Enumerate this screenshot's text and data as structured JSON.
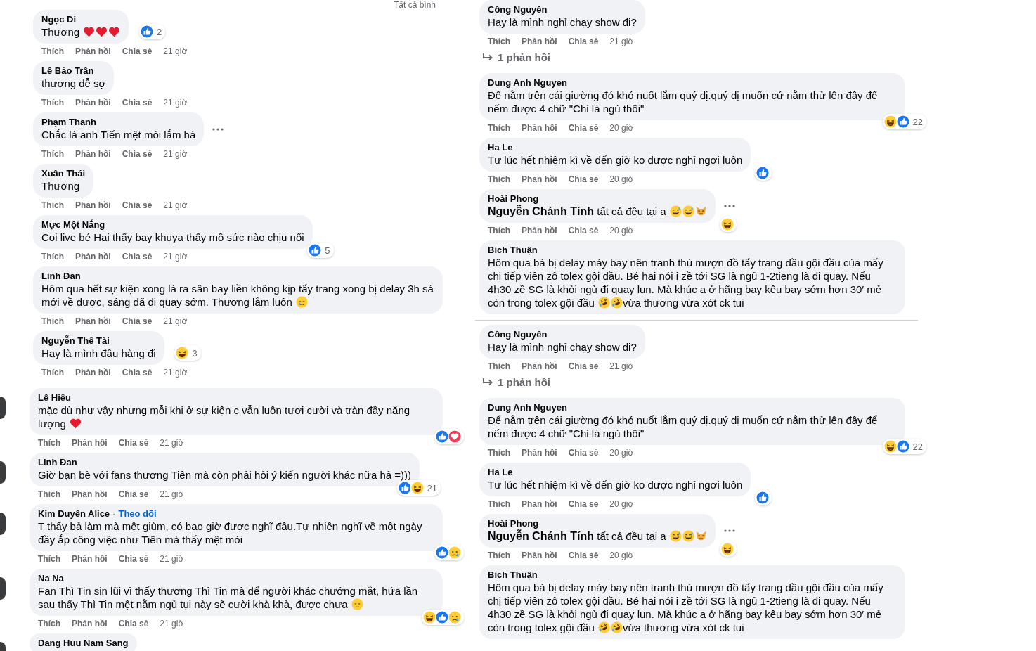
{
  "left_panels": [
    {
      "header": "Tất cả bình",
      "comments": [
        {
          "kind": "comment",
          "author": "Ngọc Di",
          "body": [
            {
              "kind": "text",
              "text": "Thương"
            },
            {
              "kind": "heart"
            },
            {
              "kind": "heart"
            },
            {
              "kind": "heart"
            }
          ],
          "reactions": {
            "icons": [
              {
                "kind": "like"
              }
            ],
            "count": "2"
          },
          "actions": [
            "Thích",
            "Phản hồi",
            "Chia sẻ"
          ],
          "time": "21 giờ"
        },
        {
          "kind": "comment",
          "author": "Lê Bảo Trân",
          "body": [
            {
              "kind": "text",
              "text": "thương dễ sợ"
            }
          ],
          "actions": [
            "Thích",
            "Phản hồi",
            "Chia sẻ"
          ],
          "time": "21 giờ"
        },
        {
          "kind": "comment",
          "author": "Phạm Thanh",
          "body": [
            {
              "kind": "text",
              "text": "Chắc là anh Tiến mệt mỏi lắm hả"
            }
          ],
          "menu": true,
          "actions": [
            "Thích",
            "Phản hồi",
            "Chia sẻ"
          ],
          "time": "21 giờ"
        },
        {
          "kind": "comment",
          "author": "Xuân Thái",
          "body": [
            {
              "kind": "text",
              "text": "Thương"
            }
          ],
          "actions": [
            "Thích",
            "Phản hồi",
            "Chia sẻ"
          ],
          "time": "21 giờ"
        },
        {
          "kind": "comment",
          "author": "Mực Một Nắng",
          "body": [
            {
              "kind": "text",
              "text": "Coi live bé Hai thấy bay khuya thấy mồ sức nào chịu nổi"
            }
          ],
          "reactions": {
            "icons": [
              {
                "kind": "like"
              }
            ],
            "count": "5"
          },
          "actions": [
            "Thích",
            "Phản hồi",
            "Chia sẻ"
          ],
          "time": "21 giờ"
        },
        {
          "kind": "comment",
          "author": "Linh Đan",
          "body": [
            {
              "kind": "text",
              "text": "Hôm qua hết sự kiện xong là ra sân bay liền không kịp tẩy trang xong bị delay 3h sá mới về được, sáng đã đi quay sớm. Thương lắm luôn"
            },
            {
              "kind": "cry"
            }
          ],
          "actions": [
            "Thích",
            "Phản hồi",
            "Chia sẻ"
          ],
          "time": "21 giờ"
        },
        {
          "kind": "comment",
          "author": "Nguyễn Thế Tài",
          "body": [
            {
              "kind": "text",
              "text": "Hay là mình đầu hàng đi"
            }
          ],
          "reactions": {
            "icons": [
              {
                "kind": "haha"
              }
            ],
            "count": "3"
          },
          "actions": [
            "Thích",
            "Phản hồi",
            "Chia sẻ"
          ],
          "time": "21 giờ"
        }
      ]
    },
    {
      "comments": [
        {
          "kind": "comment",
          "avatar": true,
          "author": "Lê Hiếu",
          "body": [
            {
              "kind": "text",
              "text": "mặc dù như vậy nhưng mỗi khi ở sự kiện c vẫn luôn tươi cười và tràn đầy năng lượng"
            },
            {
              "kind": "heart"
            }
          ],
          "reactions": {
            "icons": [
              {
                "kind": "like"
              },
              {
                "kind": "love"
              }
            ]
          },
          "actions": [
            "Thích",
            "Phản hồi",
            "Chia sẻ"
          ],
          "time": "21 giờ"
        },
        {
          "kind": "comment",
          "avatar": true,
          "author": "Linh Đan",
          "body": [
            {
              "kind": "text",
              "text": "Giờ bạn bè với fans thương Tiên mà còn phải hỏi ý kiến người khác nữa hả =)))"
            }
          ],
          "reactions": {
            "icons": [
              {
                "kind": "like"
              },
              {
                "kind": "haha"
              }
            ],
            "count": "21"
          },
          "actions": [
            "Thích",
            "Phản hồi",
            "Chia sẻ"
          ],
          "time": "21 giờ"
        },
        {
          "kind": "comment",
          "avatar": true,
          "author": "Kim Duyên Alice",
          "separator": "·",
          "follow": "Theo dõi",
          "body": [
            {
              "kind": "text",
              "text": "T thấy bả làm mà mệt giùm, có bao giờ được nghĩ đâu.Tự nhiên nghĩ về một ngày đầy ắp công việc như Tiên mà thấy mệt mỏi"
            }
          ],
          "reactions": {
            "icons": [
              {
                "kind": "like"
              },
              {
                "kind": "sad"
              }
            ]
          },
          "actions": [
            "Thích",
            "Phản hồi",
            "Chia sẻ"
          ],
          "time": "21 giờ"
        },
        {
          "kind": "comment",
          "avatar": true,
          "author": "Na Na",
          "body": [
            {
              "kind": "text",
              "text": "Fan Thì Tin sin lũi vì thấy thương Thì Tin mà để người khác chướng mắt, hứa lần sau thấy Thì Tin mệt nằm ngủ tụi này sẽ cười khà khà, được chưa"
            },
            {
              "kind": "pensive"
            }
          ],
          "reactions": {
            "icons": [
              {
                "kind": "haha"
              },
              {
                "kind": "like"
              },
              {
                "kind": "sad"
              }
            ]
          },
          "actions": [
            "Thích",
            "Phản hồi",
            "Chia sẻ"
          ],
          "time": "21 giờ"
        },
        {
          "kind": "comment",
          "avatar": true,
          "author": "Dang Huu Nam Sang"
        }
      ]
    }
  ],
  "right_panels": [
    {
      "comments": [
        {
          "kind": "comment",
          "author": "Công Nguyên",
          "body": [
            {
              "kind": "text",
              "text": "Hay là mình nghỉ chạy show đi?"
            }
          ],
          "actions": [
            "Thích",
            "Phản hồi",
            "Chia sẻ"
          ],
          "time": "21 giờ"
        },
        {
          "kind": "replies",
          "label": "1 phản hồi"
        },
        {
          "kind": "comment",
          "author": "Dung Anh Nguyen",
          "body": [
            {
              "kind": "text",
              "text": "Để nằm trên cái giường đó khó nuốt lắm quý dị.quý dị muốn cứ nằm thử lên đây để nếm được 4 chữ \"Chỉ là ngủ thôi\""
            }
          ],
          "reactions": {
            "icons": [
              {
                "kind": "haha"
              },
              {
                "kind": "like"
              }
            ],
            "count": "22"
          },
          "actions": [
            "Thích",
            "Phản hồi",
            "Chia sẻ"
          ],
          "time": "20 giờ"
        },
        {
          "kind": "comment",
          "author": "Ha Le",
          "body": [
            {
              "kind": "text",
              "text": "Tư lúc hết nhiệm kì về đến giờ ko được nghỉ ngơi luôn"
            }
          ],
          "reactions": {
            "icons": [
              {
                "kind": "like"
              }
            ]
          },
          "actions": [
            "Thích",
            "Phản hồi",
            "Chia sẻ"
          ],
          "time": "20 giờ"
        },
        {
          "kind": "comment",
          "author": "Hoài Phong",
          "body": [
            {
              "kind": "text",
              "text": "**Nguyễn Chánh Tính** tất cả đều tại a"
            },
            {
              "kind": "sweat"
            },
            {
              "kind": "sweat"
            },
            {
              "kind": "cat"
            }
          ],
          "reactions": {
            "icons": [
              {
                "kind": "haha"
              }
            ]
          },
          "menu": true,
          "actions": [
            "Thích",
            "Phản hồi",
            "Chia sẻ"
          ],
          "time": "20 giờ"
        },
        {
          "kind": "comment",
          "author": "Bích Thuận",
          "body": [
            {
              "kind": "text",
              "text": "Hôm qua bả bị delay máy bay nên tranh thủ mượn đồ tẩy trang dầu gội đầu của mấy chị tiếp viên zô tolex gội đầu. Bé hai nói i zề tới SG là ngủ 1-2tieng là đi quay. Nếu 4h30 zề SG là khỏi ngủ đi quay lun. Mà khúc a ở hãng bay kêu bay sớm hơn 30′ mẻ còn trong tolex gội đầu"
            },
            {
              "kind": "rofl"
            },
            {
              "kind": "rofl"
            },
            {
              "kind": "text",
              "text": "vừa thương vừa xót ck tui"
            }
          ]
        }
      ]
    },
    {
      "comments": [
        {
          "kind": "comment",
          "author": "Công Nguyên",
          "body": [
            {
              "kind": "text",
              "text": "Hay là mình nghỉ chạy show đi?"
            }
          ],
          "actions": [
            "Thích",
            "Phản hồi",
            "Chia sẻ"
          ],
          "time": "21 giờ"
        },
        {
          "kind": "replies",
          "label": "1 phản hồi"
        },
        {
          "kind": "comment",
          "author": "Dung Anh Nguyen",
          "body": [
            {
              "kind": "text",
              "text": "Để nằm trên cái giường đó khó nuốt lắm quý dị.quý dị muốn cứ nằm thử lên đây để nếm được 4 chữ \"Chỉ là ngủ thôi\""
            }
          ],
          "reactions": {
            "icons": [
              {
                "kind": "haha"
              },
              {
                "kind": "like"
              }
            ],
            "count": "22"
          },
          "actions": [
            "Thích",
            "Phản hồi",
            "Chia sẻ"
          ],
          "time": "20 giờ"
        },
        {
          "kind": "comment",
          "author": "Ha Le",
          "body": [
            {
              "kind": "text",
              "text": "Tư lúc hết nhiệm kì về đến giờ ko được nghỉ ngơi luôn"
            }
          ],
          "reactions": {
            "icons": [
              {
                "kind": "like"
              }
            ]
          },
          "actions": [
            "Thích",
            "Phản hồi",
            "Chia sẻ"
          ],
          "time": "20 giờ"
        },
        {
          "kind": "comment",
          "author": "Hoài Phong",
          "body": [
            {
              "kind": "text",
              "text": "**Nguyễn Chánh Tính** tất cả đều tại a"
            },
            {
              "kind": "sweat"
            },
            {
              "kind": "sweat"
            },
            {
              "kind": "cat"
            }
          ],
          "reactions": {
            "icons": [
              {
                "kind": "haha"
              }
            ]
          },
          "menu": true,
          "actions": [
            "Thích",
            "Phản hồi",
            "Chia sẻ"
          ],
          "time": "20 giờ"
        },
        {
          "kind": "comment",
          "author": "Bích Thuận",
          "body": [
            {
              "kind": "text",
              "text": "Hôm qua bả bị delay máy bay nên tranh thủ mượn đồ tẩy trang dầu gội đầu của mấy chị tiếp viên zô tolex gội đầu. Bé hai nói i zề tới SG là ngủ 1-2tieng là đi quay. Nếu 4h30 zề SG là khỏi ngủ đi quay lun. Mà khúc a ở hãng bay kêu bay sớm hơn 30′ mẻ còn trong tolex gội đầu"
            },
            {
              "kind": "rofl"
            },
            {
              "kind": "rofl"
            },
            {
              "kind": "text",
              "text": "vừa thương vừa xót ck tui"
            }
          ]
        }
      ]
    }
  ]
}
